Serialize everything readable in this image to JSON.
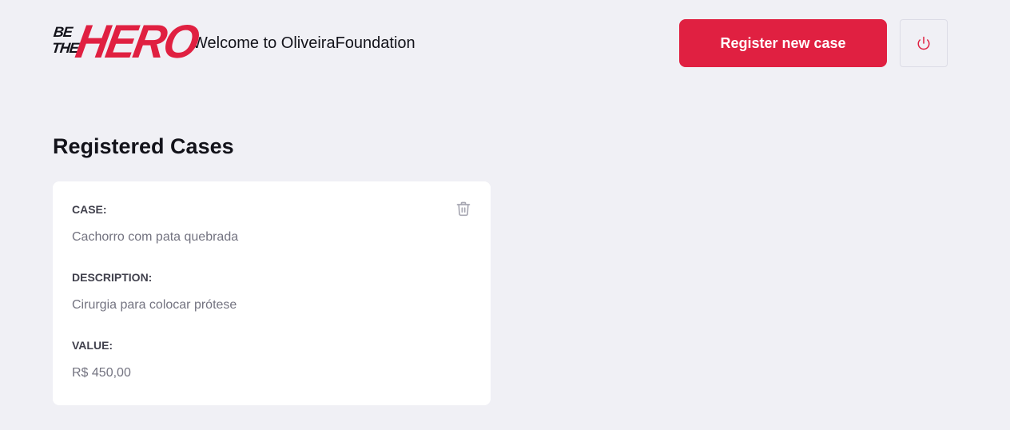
{
  "header": {
    "logo": {
      "line1": "BE",
      "line2": "THE",
      "main": "HERO"
    },
    "welcome_text": "Welcome to OliveiraFoundation",
    "register_button": "Register new case",
    "logout_icon": "power-icon"
  },
  "main": {
    "title": "Registered Cases",
    "cases": [
      {
        "case_label": "CASE:",
        "case_value": "Cachorro com pata quebrada",
        "description_label": "DESCRIPTION:",
        "description_value": "Cirurgia para colocar prótese",
        "value_label": "VALUE:",
        "value_value": "R$ 450,00",
        "delete_icon": "trash-icon"
      }
    ]
  },
  "colors": {
    "accent": "#e02041",
    "background": "#f0f0f5",
    "card": "#ffffff",
    "label": "#41414d",
    "muted": "#737380",
    "icon": "#a8a8b3"
  }
}
